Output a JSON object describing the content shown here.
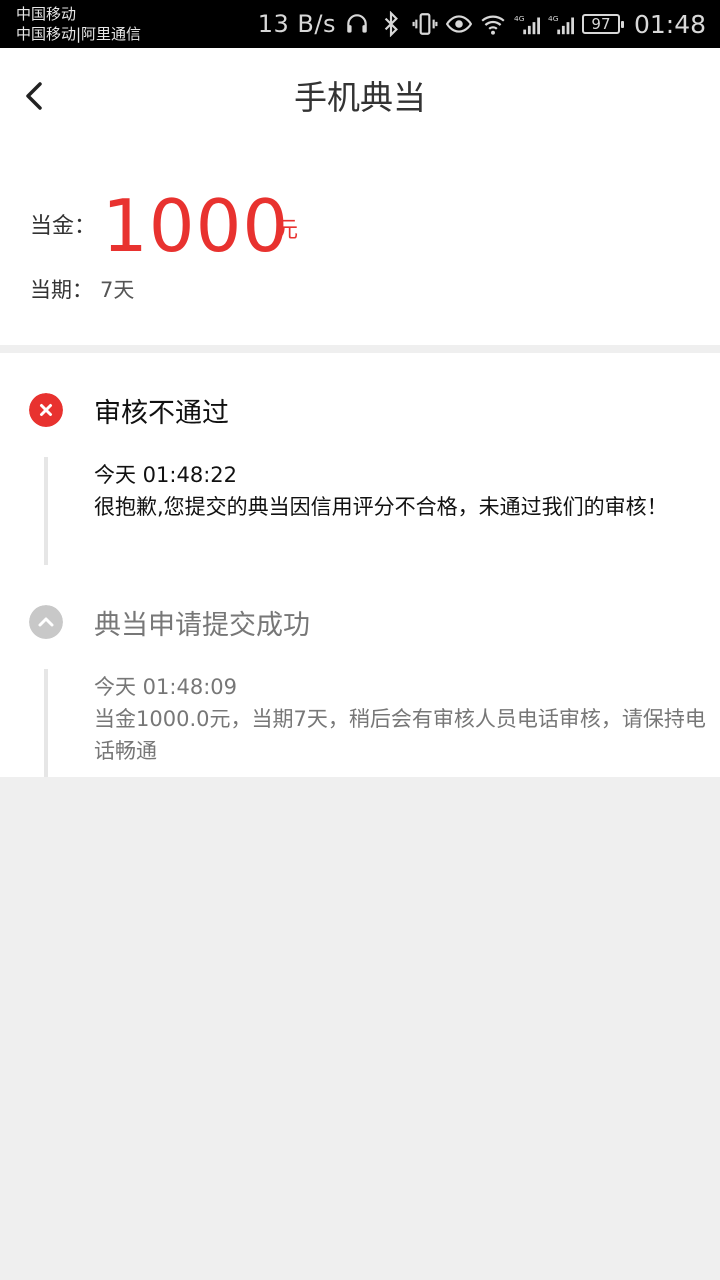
{
  "status_bar": {
    "carrier_1": "中国移动",
    "carrier_2": "中国移动|阿里通信",
    "speed": "13 B/s",
    "signal_label_1": "4G",
    "signal_label_2": "4G",
    "battery": "97",
    "time": "01:48"
  },
  "header": {
    "title": "手机典当"
  },
  "loan": {
    "amount_label": "当金：",
    "amount": "1000",
    "unit": "元",
    "term_label": "当期：",
    "term": "7天"
  },
  "timeline": [
    {
      "status": "rejected",
      "title": "审核不通过",
      "time": "今天 01:48:22",
      "message": "很抱歉,您提交的典当因信用评分不合格，未通过我们的审核！"
    },
    {
      "status": "submitted",
      "title": "典当申请提交成功",
      "time": "今天 01:48:09",
      "message": "当金1000.0元，当期7天，稍后会有审核人员电话审核，请保持电话畅通"
    }
  ],
  "colors": {
    "accent_red": "#e8322f",
    "muted_gray": "#c8c8c8",
    "background": "#efefef"
  }
}
